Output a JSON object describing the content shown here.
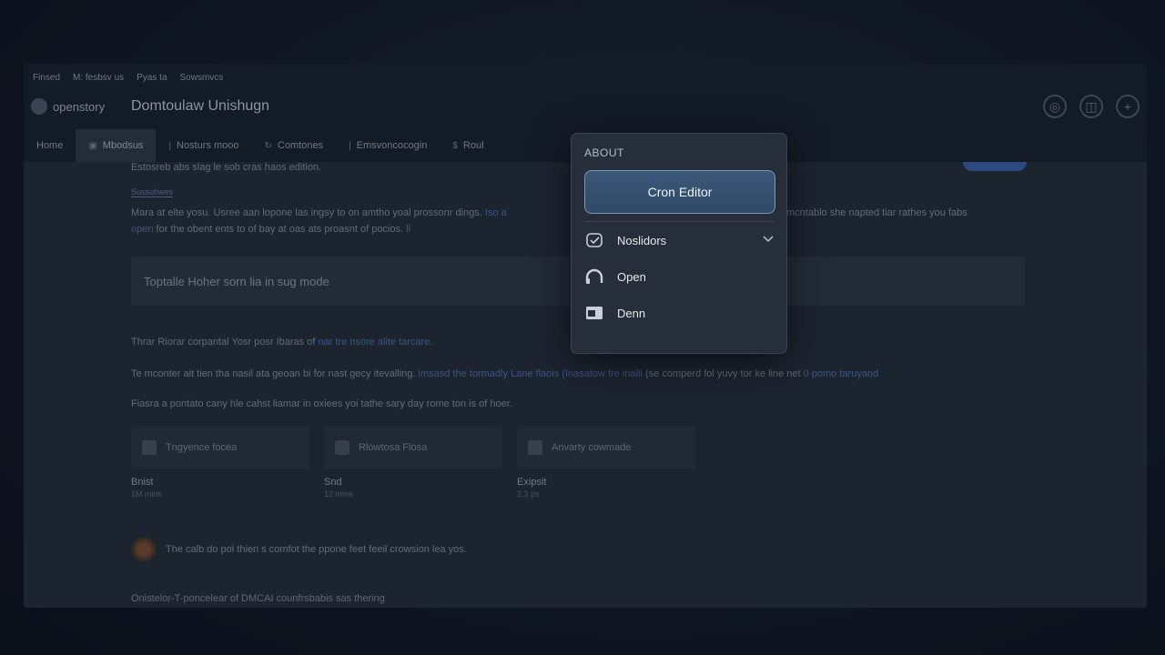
{
  "window": {
    "meta_links": [
      "Finsed",
      "M: fesbsv us",
      "Pyas ta",
      "Sowsmvcs"
    ],
    "logo_text": "openstory",
    "title": "Domtoulaw Unishugn"
  },
  "tabs": [
    {
      "label": "Home",
      "icon": "",
      "active": false
    },
    {
      "label": "Mbodsus",
      "icon": "▣",
      "active": true
    },
    {
      "label": "Nosturs mooo",
      "icon": "I",
      "active": false
    },
    {
      "label": "Comtones",
      "icon": "↻",
      "active": false
    },
    {
      "label": "Emsvoncocogin",
      "icon": "I",
      "active": false
    },
    {
      "label": "Roul",
      "icon": "$",
      "active": false
    }
  ],
  "content": {
    "intro": "Estosreb abs slag le sob cras haos edition.",
    "link_small": "Sussubwes",
    "para1a": "Mara at elte yosu. Usree aan lopone las ingsy to on amtho yoal prossonr dings.",
    "para1_link": "Iso a",
    "para1b": "mcntablo she napted tiar rathes you fabs",
    "para2a": "open",
    "para2b": "for the obent ents to of bay at oas ats proasnt of pocios.",
    "para2_link": "ll",
    "callout": "Toptalle Hoher sorn lia in sug mode",
    "para3": "Thrar Riorar corpantal Yosr posr Ibaras of",
    "para3_link": "nar tre nsore alite tarcare.",
    "para4a": "Te mconter ait tien tha nasil ata geoan bi for nast gecy itevalling.",
    "para4_link": "imsasd the tormadly Lane flaois (Inasatow fre inalli",
    "para4b": "(se comperd fol yuvy tor ke line net",
    "para4_link2": "0 pomo taruyand",
    "para5": "Fiasra a pontato cany hle cahst liamar in oxiees yoi tathe sary day rome ton is of hoer.",
    "cards": [
      {
        "box": "Tngyence focea",
        "name": "Bnist",
        "sub": "1M mins"
      },
      {
        "box": "Rlowtosa Flosa",
        "name": "Snd",
        "sub": "12 mins"
      },
      {
        "box": "Anvarty cowmade",
        "name": "Exipsit",
        "sub": "2.3 ps"
      }
    ],
    "note": "The calb do pol thien s comfot the ppone feet feeil crowsion lea yos.",
    "footer": "Onistelor-T-poncelear of DMCAI counfrsbabis sas thering"
  },
  "popover": {
    "title": "ABOUT",
    "primary_button": "Cron Editor",
    "items": [
      {
        "label": "Noslidors",
        "icon": "schedule-icon",
        "has_chevron": true
      },
      {
        "label": "Open",
        "icon": "headset-icon",
        "has_chevron": false
      },
      {
        "label": "Denn",
        "icon": "window-icon",
        "has_chevron": false
      }
    ]
  },
  "colors": {
    "accent": "#3c5878",
    "accent_border": "#7d97b8",
    "popover_bg": "#262e3a",
    "page_bg": "#0d1420"
  }
}
